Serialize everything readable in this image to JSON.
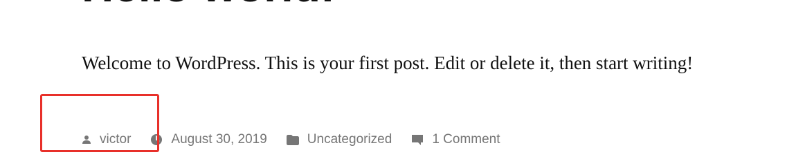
{
  "post": {
    "title": "Hello world!",
    "body": "Welcome to WordPress. This is your first post. Edit or delete it, then start writing!"
  },
  "meta": {
    "author": "victor",
    "date": "August 30, 2019",
    "category": "Uncategorized",
    "comments": "1 Comment"
  },
  "icons": {
    "author": "person-icon",
    "date": "clock-icon",
    "category": "folder-icon",
    "comments": "comment-icon"
  },
  "colors": {
    "meta_text": "#767676",
    "body_text": "#111111",
    "highlight": "#e8302a"
  }
}
